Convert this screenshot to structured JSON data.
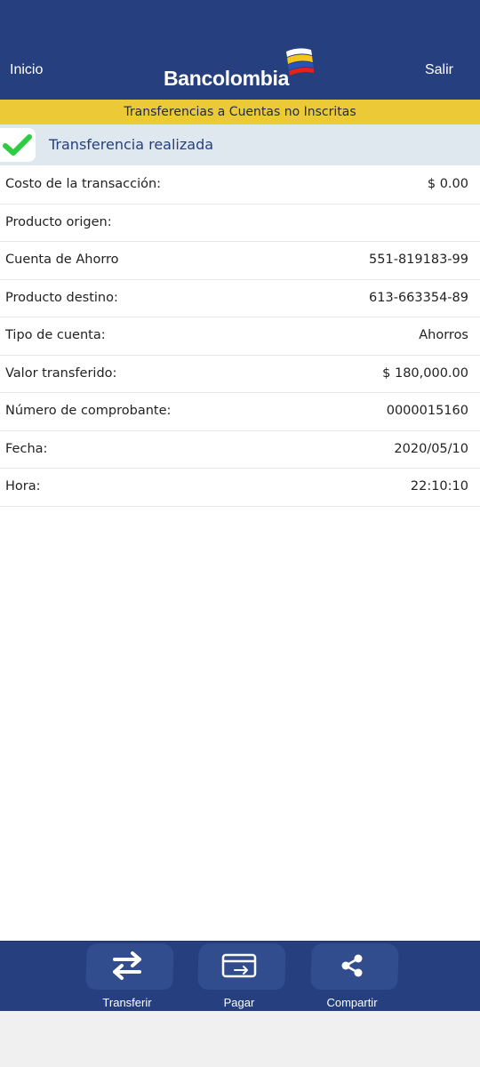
{
  "header": {
    "left_link": "Inicio",
    "right_link": "Salir",
    "brand": "Bancolombia"
  },
  "banner": {
    "title": "Transferencias a Cuentas no Inscritas"
  },
  "status": {
    "text": "Transferencia realizada",
    "check_color": "#2ecc40"
  },
  "details": [
    {
      "label": "Costo de la transacción:",
      "value": "$ 0.00"
    },
    {
      "label": "Producto origen:",
      "value": ""
    },
    {
      "label": "Cuenta de Ahorro",
      "value": "551-819183-99"
    },
    {
      "label": "Producto destino:",
      "value": "613-663354-89"
    },
    {
      "label": "Tipo de cuenta:",
      "value": "Ahorros"
    },
    {
      "label": "Valor transferido:",
      "value": "$ 180,000.00"
    },
    {
      "label": "Número de comprobante:",
      "value": "0000015160"
    },
    {
      "label": "Fecha:",
      "value": "2020/05/10"
    },
    {
      "label": "Hora:",
      "value": "22:10:10"
    }
  ],
  "actions": [
    {
      "label": "Transferir",
      "icon": "transfer-arrows-icon"
    },
    {
      "label": "Pagar",
      "icon": "card-pay-icon"
    },
    {
      "label": "Compartir",
      "icon": "share-icon"
    }
  ],
  "colors": {
    "brand_blue": "#263f7e",
    "banner_yellow": "#ecc937",
    "success_bg": "#dfe7ef"
  }
}
